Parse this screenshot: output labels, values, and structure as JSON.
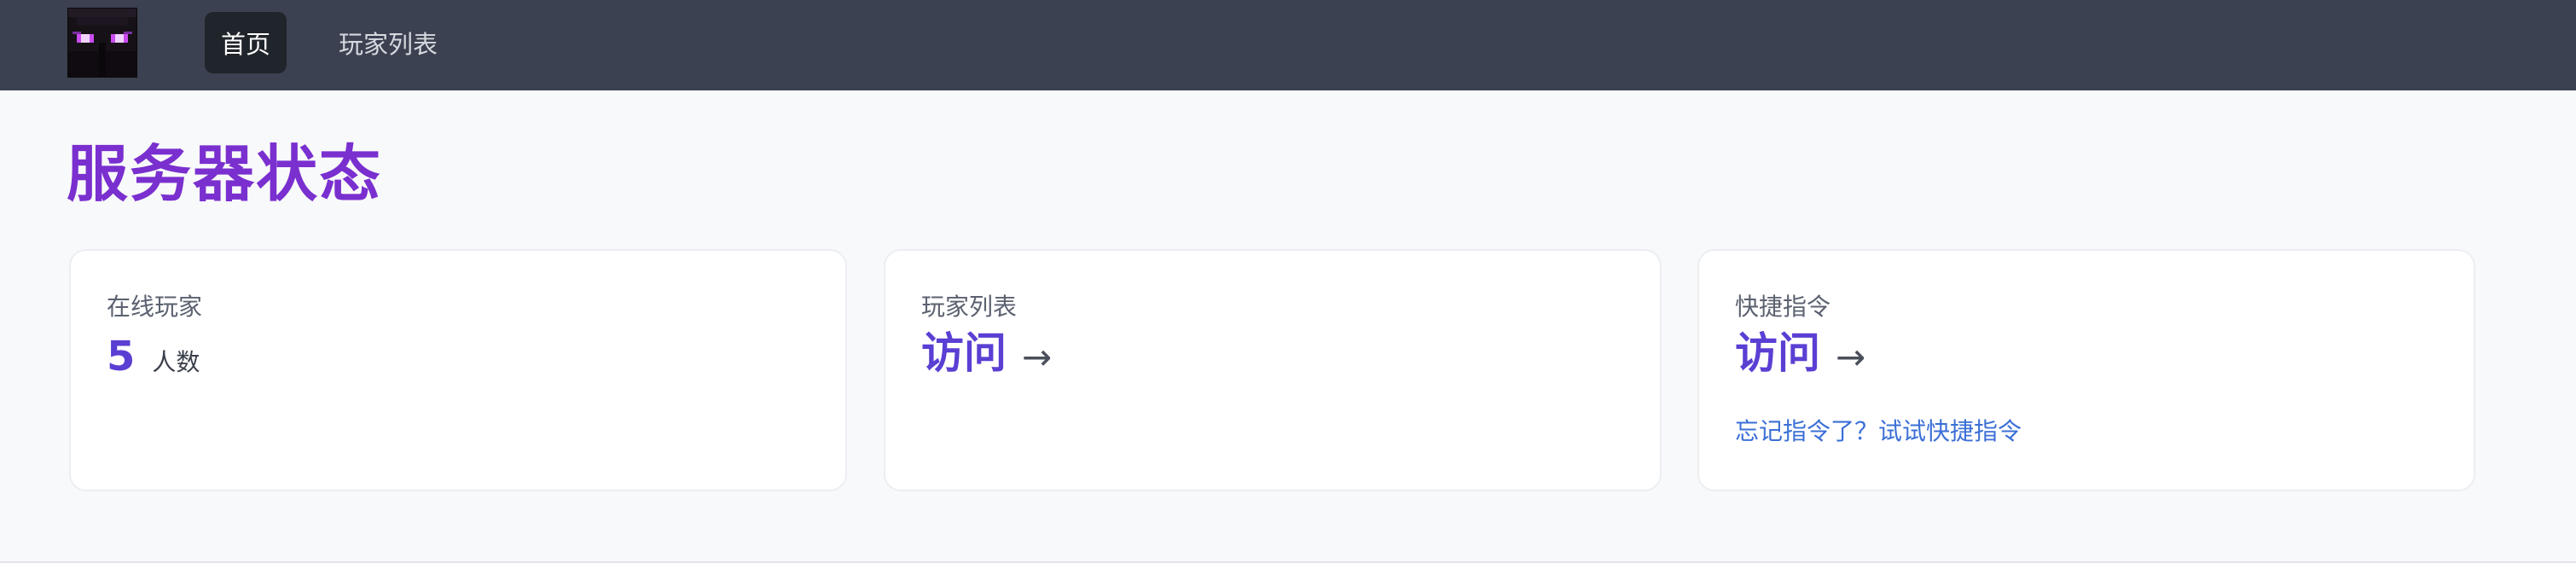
{
  "nav": {
    "logo_icon": "enderman-avatar-icon",
    "items": [
      {
        "label": "首页",
        "active": true
      },
      {
        "label": "玩家列表",
        "active": false
      }
    ]
  },
  "page": {
    "title": "服务器状态"
  },
  "cards": {
    "online": {
      "label": "在线玩家",
      "count": "5",
      "unit": "人数"
    },
    "players": {
      "label": "玩家列表",
      "link_text": "访问",
      "arrow": "→"
    },
    "commands": {
      "label": "快捷指令",
      "link_text": "访问",
      "arrow": "→",
      "hint": "忘记指令了？试试快捷指令"
    }
  },
  "colors": {
    "navbar_bg": "#3b4150",
    "title": "#7a2fcf",
    "accent": "#5b3fd3",
    "link": "#3b6fd6",
    "page_bg": "#f8f9fa"
  }
}
